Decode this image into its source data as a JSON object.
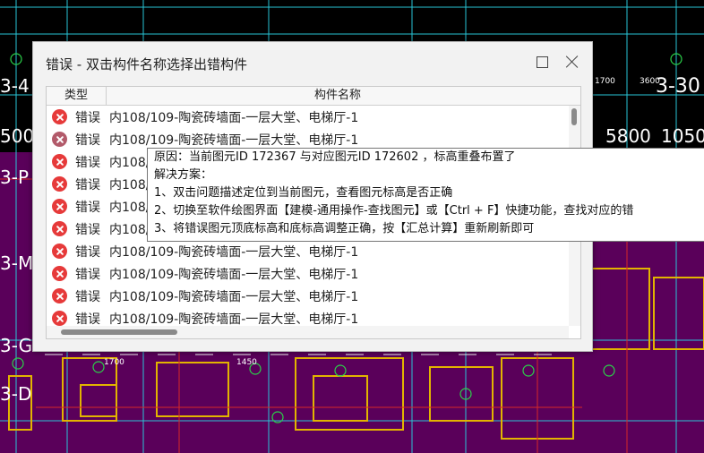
{
  "colors": {
    "cad_background": "#000000",
    "cad_wall": "#5a005a",
    "cad_line_cyan": "#29c5d6",
    "cad_line_yellow": "#e2b400",
    "cad_line_red": "#d62828",
    "error_red": "#e63a3a"
  },
  "cad": {
    "axis_labels": [
      "3-4",
      "3-30",
      "3-P",
      "3-M",
      "3-G",
      "3-D"
    ],
    "dimensions": [
      "500",
      "5800",
      "1050",
      "1700",
      "3600",
      "1700",
      "1450"
    ]
  },
  "dialog": {
    "title": "错误 - 双击构件名称选择出错构件",
    "maximize_icon": "maximize-icon",
    "close_icon": "close-icon",
    "columns": {
      "type": "类型",
      "name": "构件名称"
    },
    "rows": [
      {
        "type": "错误",
        "name": "内108/109-陶瓷砖墙面-一层大堂、电梯厅-1",
        "icon": "error-icon"
      },
      {
        "type": "错误",
        "name": "内108/109-陶瓷砖墙面-一层大堂、电梯厅-1",
        "icon": "error-icon"
      },
      {
        "type": "错误",
        "name": "内108/109-陶瓷砖墙面-一层大堂、电梯厅-1",
        "icon": "error-icon"
      },
      {
        "type": "错误",
        "name": "内108/109-陶瓷砖墙面-一层大堂、电梯厅-1",
        "icon": "error-icon"
      },
      {
        "type": "错误",
        "name": "内108/109-陶瓷砖墙面-一层大堂、电梯厅-1",
        "icon": "error-icon"
      },
      {
        "type": "错误",
        "name": "内108/109-陶瓷砖墙面-一层大堂、电梯厅-1",
        "icon": "error-icon"
      },
      {
        "type": "错误",
        "name": "内108/109-陶瓷砖墙面-一层大堂、电梯厅-1",
        "icon": "error-icon"
      },
      {
        "type": "错误",
        "name": "内108/109-陶瓷砖墙面-一层大堂、电梯厅-1",
        "icon": "error-icon"
      },
      {
        "type": "错误",
        "name": "内108/109-陶瓷砖墙面-一层大堂、电梯厅-1",
        "icon": "error-icon"
      },
      {
        "type": "错误",
        "name": "内108/109-陶瓷砖墙面-一层大堂、电梯厅-1",
        "icon": "error-icon"
      }
    ]
  },
  "tooltip": {
    "lines": [
      "原因：当前图元ID 172367 与对应图元ID 172602 ，标高重叠布置了",
      "解决方案：",
      "1、双击问题描述定位到当前图元，查看图元标高是否正确",
      "2、切换至软件绘图界面【建模-通用操作-查找图元】或【Ctrl + F】快捷功能，查找对应的错",
      "3、将错误图元顶底标高和底标高调整正确，按【汇总计算】重新刷新即可"
    ]
  }
}
